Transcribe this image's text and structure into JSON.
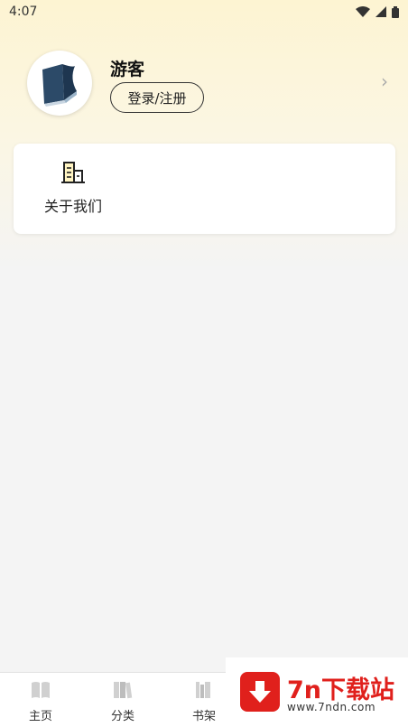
{
  "status_bar": {
    "time": "4:07"
  },
  "profile": {
    "username": "游客",
    "login_label": "登录/注册"
  },
  "menu": {
    "items": [
      {
        "label": "关于我们",
        "icon": "building-icon"
      }
    ]
  },
  "tab_bar": {
    "tabs": [
      {
        "label": "主页",
        "icon": "book-open-icon"
      },
      {
        "label": "分类",
        "icon": "books-icon"
      },
      {
        "label": "书架",
        "icon": "bookshelf-icon"
      }
    ]
  },
  "watermark": {
    "title": "7n下载站",
    "url": "www.7ndn.com",
    "color": "#e0201c"
  },
  "colors": {
    "header_gradient_top": "#fdf4d2",
    "background": "#f4f4f4"
  }
}
